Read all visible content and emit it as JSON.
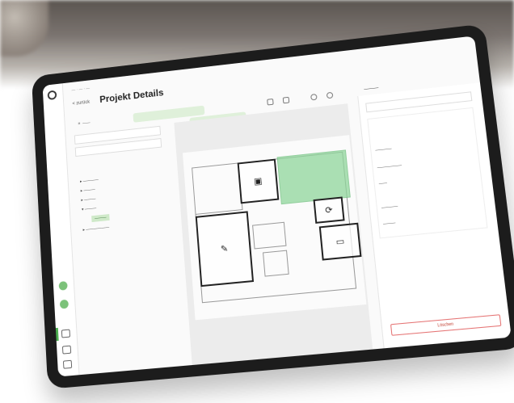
{
  "header": {
    "title": "Projekt Details",
    "back_label": "< zurück"
  },
  "panel": {
    "button_label": "Löschen"
  }
}
